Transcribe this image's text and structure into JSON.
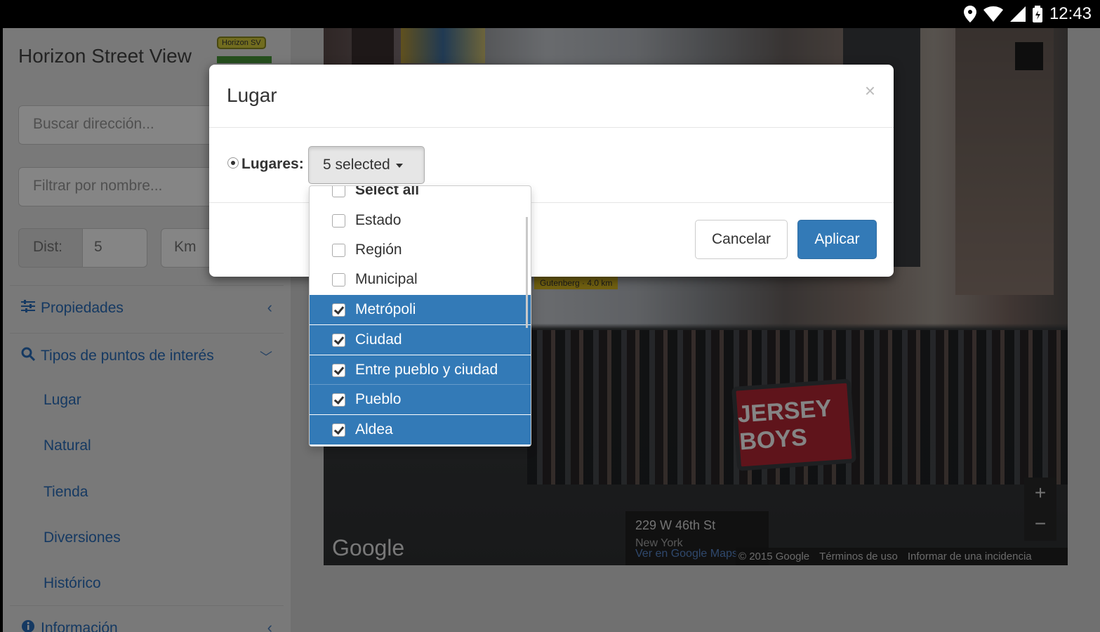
{
  "status_bar": {
    "time": "12:43"
  },
  "sidebar": {
    "title": "Horizon Street View",
    "badge": "Horizon SV",
    "search_placeholder": "Buscar dirección...",
    "filter_placeholder": "Filtrar por nombre...",
    "dist_label": "Dist:",
    "dist_value": "5",
    "unit": "Km",
    "panels": [
      {
        "label": "Propiedades",
        "icon": "sliders-icon"
      },
      {
        "label": "Tipos de puntos de interés",
        "icon": "search-icon"
      },
      {
        "label": "Información",
        "icon": "info-icon"
      }
    ],
    "poi_types": [
      "Lugar",
      "Natural",
      "Tienda",
      "Diversiones",
      "Histórico"
    ]
  },
  "map": {
    "address_street": "229 W 46th St",
    "address_city": "New York",
    "address_link": "Ver en Google Maps",
    "logo": "Google",
    "footer": [
      "© 2015 Google",
      "Términos de uso",
      "Informar de una incidencia"
    ],
    "billboard": "JERSEY BOYS",
    "tag": "Gutenberg · 4.0 km"
  },
  "modal": {
    "title": "Lugar",
    "close": "×",
    "field_label": "Lugares:",
    "multiselect_value": "5 selected",
    "cancel_label": "Cancelar",
    "apply_label": "Aplicar",
    "options": [
      {
        "label": "Select all",
        "checked": false
      },
      {
        "label": "Estado",
        "checked": false
      },
      {
        "label": "Región",
        "checked": false
      },
      {
        "label": "Municipal",
        "checked": false
      },
      {
        "label": "Metrópoli",
        "checked": true
      },
      {
        "label": "Ciudad",
        "checked": true
      },
      {
        "label": "Entre pueblo y ciudad",
        "checked": true
      },
      {
        "label": "Pueblo",
        "checked": true
      },
      {
        "label": "Aldea",
        "checked": true
      }
    ]
  },
  "colors": {
    "accent": "#337ab7",
    "link": "#2a6ebd"
  }
}
